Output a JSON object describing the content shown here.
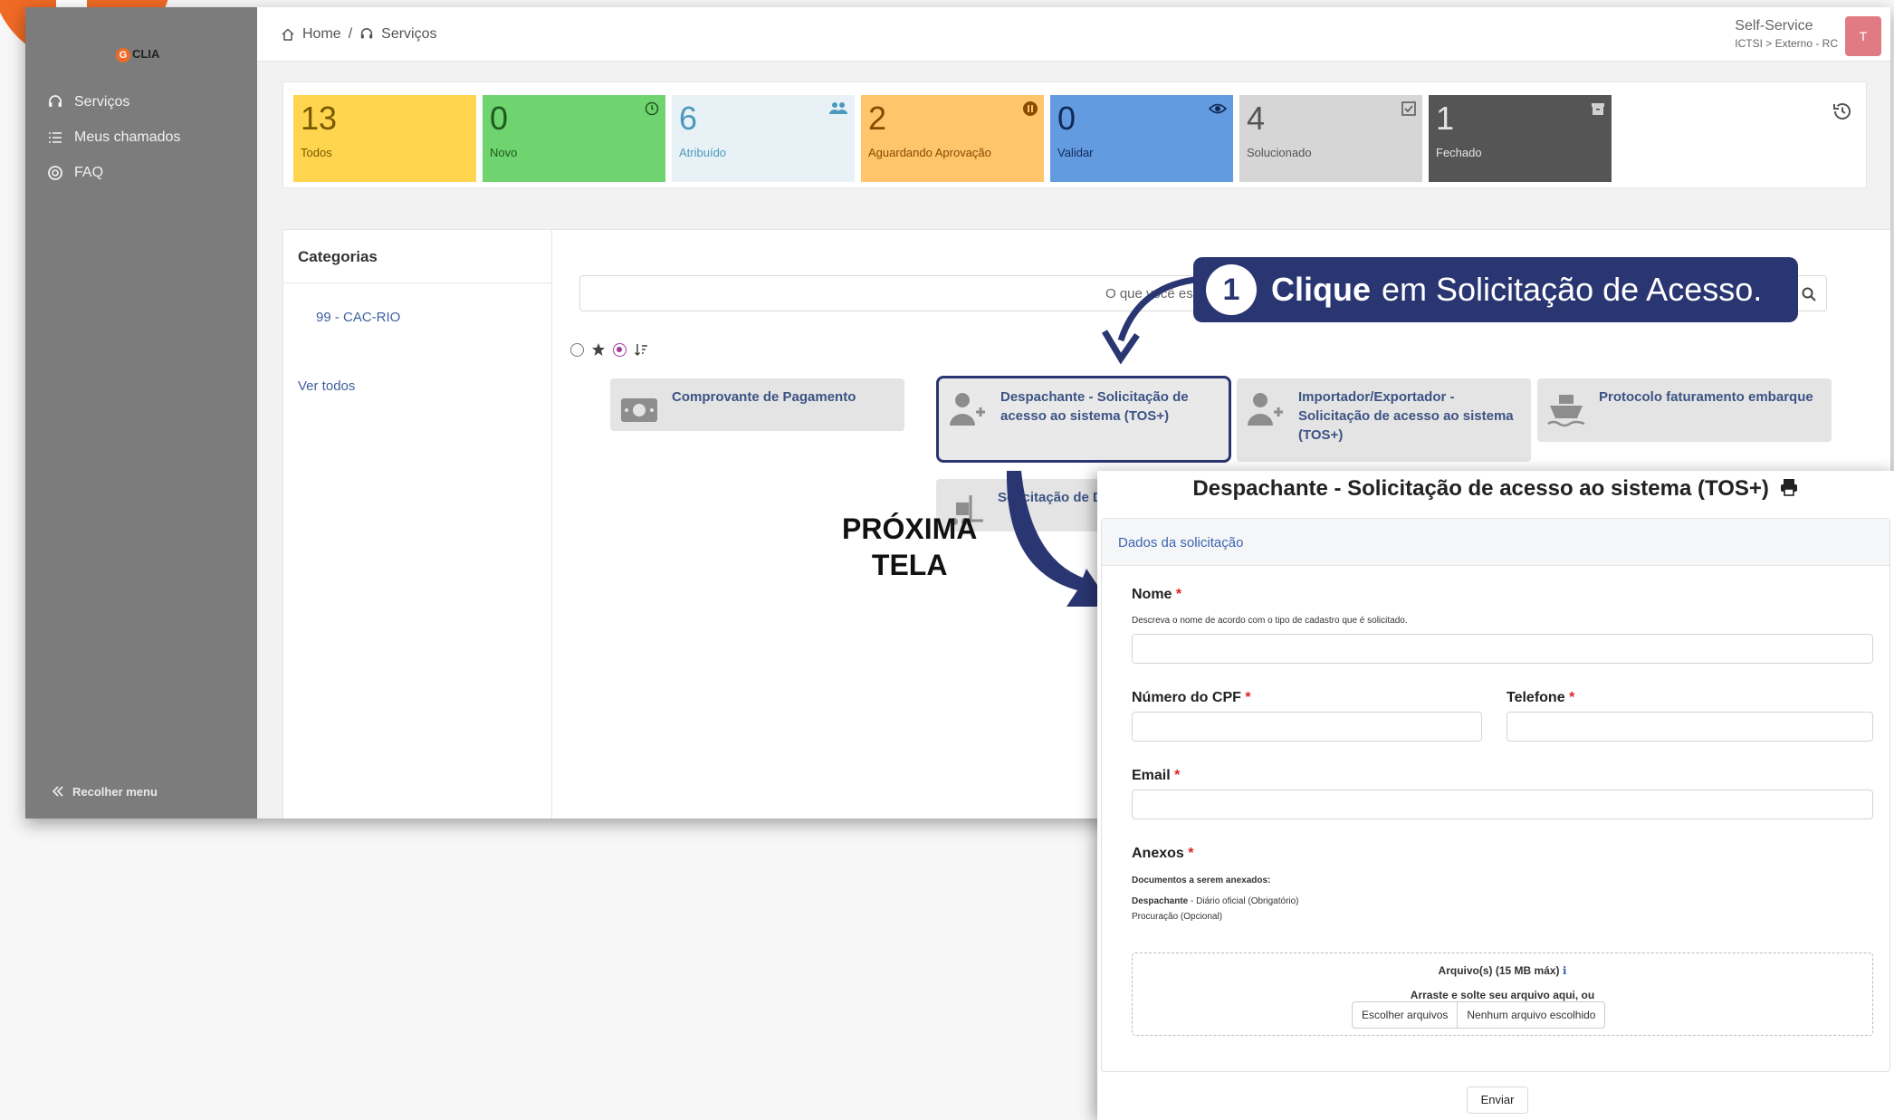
{
  "sidebar": {
    "logo_text": "CLIA",
    "items": [
      {
        "label": "Serviços",
        "icon": "headset-icon"
      },
      {
        "label": "Meus chamados",
        "icon": "list-icon"
      },
      {
        "label": "FAQ",
        "icon": "help-circle-icon"
      }
    ],
    "collapse_label": "Recolher menu"
  },
  "topbar": {
    "breadcrumb": [
      "Home",
      "/",
      "Serviços"
    ],
    "user_title": "Self-Service",
    "user_path": "ICTSI > Externo - RC",
    "avatar_initial": "T"
  },
  "stats": [
    {
      "count": "13",
      "label": "Todos",
      "bg": "#ffd54f",
      "fg": "#7a5b00"
    },
    {
      "count": "0",
      "label": "Novo",
      "bg": "#6fd36f",
      "fg": "#1f5a1f",
      "icon": "clock-icon"
    },
    {
      "count": "6",
      "label": "Atribuído",
      "bg": "#e8f2f6",
      "fg": "#4a99bd",
      "icon": "users-icon"
    },
    {
      "count": "2",
      "label": "Aguardando Aprovação",
      "bg": "#ffc56b",
      "fg": "#8a4a00",
      "icon": "pause-icon"
    },
    {
      "count": "0",
      "label": "Validar",
      "bg": "#639be0",
      "fg": "#102a57",
      "icon": "eye-icon"
    },
    {
      "count": "4",
      "label": "Solucionado",
      "bg": "#d6d6d6",
      "fg": "#555",
      "icon": "check-square-icon"
    },
    {
      "count": "1",
      "label": "Fechado",
      "bg": "#555555",
      "fg": "#e4e4e4",
      "icon": "archive-icon"
    }
  ],
  "categories": {
    "title": "Categorias",
    "item": "99 - CAC-RIO",
    "see_all": "Ver todos"
  },
  "search": {
    "placeholder": "O que você es"
  },
  "services": [
    {
      "title": "Comprovante de Pagamento",
      "icon": "money-icon"
    },
    {
      "title": "Despachante - Solicitação de acesso ao sistema (TOS+)",
      "icon": "user-add-icon"
    },
    {
      "title": "Importador/Exportador - Solicitação de acesso ao sistema (TOS+)",
      "icon": "user-add-icon"
    },
    {
      "title": "Protocolo faturamento embarque",
      "icon": "ship-icon"
    },
    {
      "title": "Solicitação de Des",
      "icon": "forklift-icon"
    }
  ],
  "callout": {
    "number": "1",
    "bold": "Clique",
    "text": "em Solicitação de Acesso."
  },
  "next_screen": [
    "PRÓXIMA",
    "TELA"
  ],
  "form": {
    "title": "Despachante - Solicitação de acesso ao sistema (TOS+)",
    "section": "Dados da solicitação",
    "nome_label": "Nome",
    "nome_hint": "Descreva o nome de acordo com o tipo de cadastro que é solicitado.",
    "cpf_label": "Número do CPF",
    "telefone_label": "Telefone",
    "email_label": "Email",
    "anexos_label": "Anexos",
    "anexos_hint1": "Documentos a serem anexados:",
    "anexos_hint2_bold": "Despachante",
    "anexos_hint2": " - Diário oficial (Obrigatório)",
    "anexos_hint3": "Procuração (Opcional)",
    "files_label": "Arquivo(s) (15 MB máx)",
    "drop_text": "Arraste e solte seu arquivo aqui, ou",
    "choose_files": "Escolher arquivos",
    "no_file": "Nenhum arquivo escolhido",
    "required_mark": "*",
    "submit": "Enviar"
  }
}
